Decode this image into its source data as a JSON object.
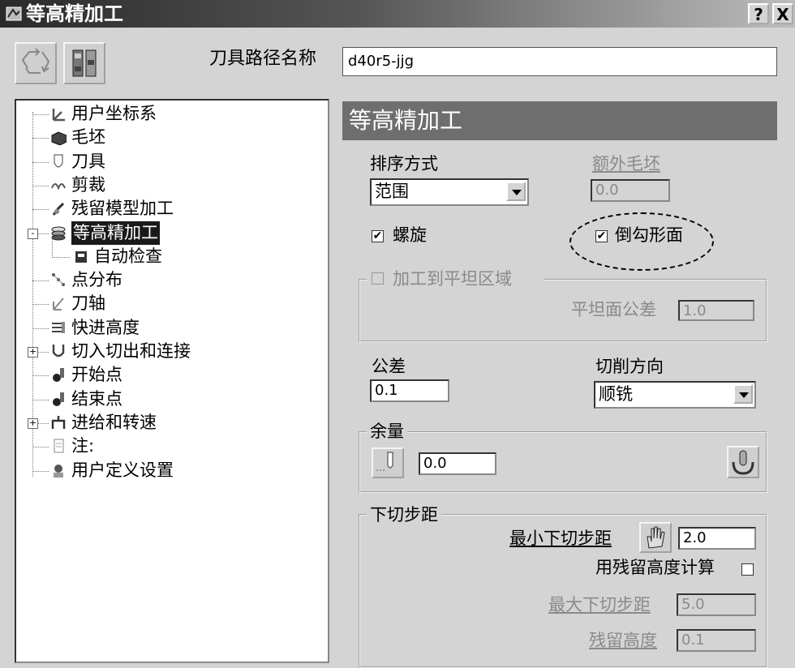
{
  "window": {
    "title": "等高精加工",
    "help_label": "?",
    "close_label": "X"
  },
  "toolbar": {
    "name_label": "刀具路径名称",
    "name_value": "d40r5-jjg"
  },
  "tree": {
    "items": [
      {
        "label": "用户坐标系",
        "icon": "ucs-icon"
      },
      {
        "label": "毛坯",
        "icon": "block-icon"
      },
      {
        "label": "刀具",
        "icon": "tool-icon"
      },
      {
        "label": "剪裁",
        "icon": "trim-icon"
      },
      {
        "label": "残留模型加工",
        "icon": "rest-model-icon"
      },
      {
        "label": "等高精加工",
        "icon": "constant-z-icon",
        "selected": true,
        "expander": "-"
      },
      {
        "label": "自动检查",
        "icon": "auto-check-icon",
        "child": true
      },
      {
        "label": "点分布",
        "icon": "point-distribution-icon"
      },
      {
        "label": "刀轴",
        "icon": "tool-axis-icon"
      },
      {
        "label": "快进高度",
        "icon": "rapid-height-icon"
      },
      {
        "label": "切入切出和连接",
        "icon": "leads-links-icon",
        "expander": "+"
      },
      {
        "label": "开始点",
        "icon": "start-point-icon"
      },
      {
        "label": "结束点",
        "icon": "end-point-icon"
      },
      {
        "label": "进给和转速",
        "icon": "feeds-speeds-icon",
        "expander": "+"
      },
      {
        "label": "注:",
        "icon": "notes-icon"
      },
      {
        "label": "用户定义设置",
        "icon": "user-settings-icon"
      }
    ]
  },
  "panel": {
    "header": "等高精加工",
    "ordering_label": "排序方式",
    "ordering_value": "范围",
    "extra_stock_label": "额外毛坯",
    "extra_stock_value": "0.0",
    "spiral_label": "螺旋",
    "undercut_label": "倒勾形面",
    "flat_group_label": "加工到平坦区域",
    "flat_tol_label": "平坦面公差",
    "flat_tol_value": "1.0",
    "tolerance_label": "公差",
    "tolerance_value": "0.1",
    "cut_dir_label": "切削方向",
    "cut_dir_value": "顺铣",
    "allowance_group_label": "余量",
    "allowance_value": "0.0",
    "stepdown_group_label": "下切步距",
    "min_stepdown_label": "最小下切步距",
    "min_stepdown_value": "2.0",
    "cusp_calc_label": "用残留高度计算",
    "max_stepdown_label": "最大下切步距",
    "max_stepdown_value": "5.0",
    "cusp_label": "残留高度",
    "cusp_value": "0.1"
  },
  "checkmark": "✔"
}
